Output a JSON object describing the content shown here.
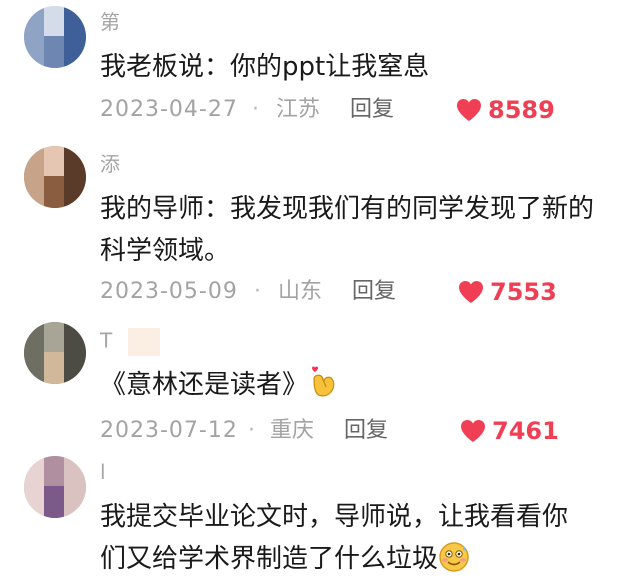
{
  "comments": [
    {
      "username": "第",
      "text": "我老板说：你的ppt让我窒息",
      "date": "2023-04-27",
      "separator": "·",
      "location": "江苏",
      "reply_label": "回复",
      "likes": "8589"
    },
    {
      "username": "添",
      "text": "我的导师：我发现我们有的同学发现了新的科学领域。",
      "date": "2023-05-09",
      "separator": "·",
      "location": "山东",
      "reply_label": "回复",
      "likes": "7553"
    },
    {
      "username": "T",
      "text": "《意林还是读者》",
      "emoji": "finger-heart-emoji",
      "date": "2023-07-12",
      "separator": "·",
      "location": "重庆",
      "reply_label": "回复",
      "likes": "7461"
    },
    {
      "username": "l",
      "text": "我提交毕业论文时，导师说，让我看看你们又给学术界制造了什么垃圾",
      "emoji": "awkward-smile-emoji"
    }
  ],
  "colors": {
    "like": "#f03f55",
    "meta": "#a3a3a3",
    "text": "#1a1a1a"
  }
}
